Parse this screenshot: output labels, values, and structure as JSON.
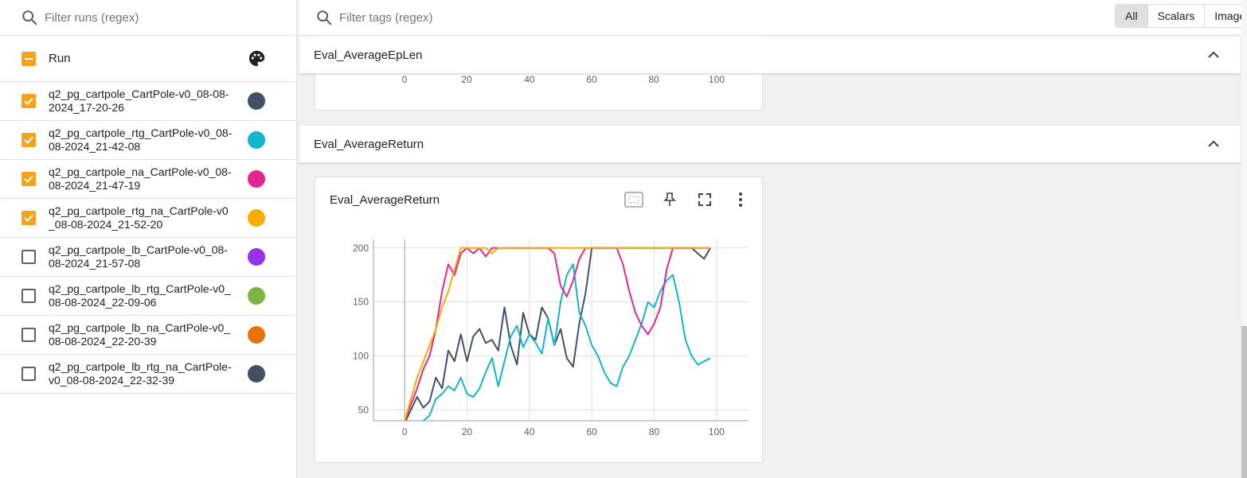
{
  "sidebar": {
    "filter_placeholder": "Filter runs (regex)",
    "header_label": "Run",
    "header_icon": "palette-icon",
    "runs": [
      {
        "name": "q2_pg_cartpole_CartPole-v0_08-08-2024_17-20-26",
        "checked": true,
        "color": "#425066"
      },
      {
        "name": "q2_pg_cartpole_rtg_CartPole-v0_08-08-2024_21-42-08",
        "checked": true,
        "color": "#12b5cb"
      },
      {
        "name": "q2_pg_cartpole_na_CartPole-v0_08-08-2024_21-47-19",
        "checked": true,
        "color": "#e52592"
      },
      {
        "name": "q2_pg_cartpole_rtg_na_CartPole-v0_08-08-2024_21-52-20",
        "checked": true,
        "color": "#f9ab00"
      },
      {
        "name": "q2_pg_cartpole_lb_CartPole-v0_08-08-2024_21-57-08",
        "checked": false,
        "color": "#9334e6"
      },
      {
        "name": "q2_pg_cartpole_lb_rtg_CartPole-v0_08-08-2024_22-09-06",
        "checked": false,
        "color": "#7cb342"
      },
      {
        "name": "q2_pg_cartpole_lb_na_CartPole-v0_08-08-2024_22-20-39",
        "checked": false,
        "color": "#e8710a"
      },
      {
        "name": "q2_pg_cartpole_lb_rtg_na_CartPole-v0_08-08-2024_22-32-39",
        "checked": false,
        "color": "#425066"
      }
    ]
  },
  "topbar": {
    "filter_placeholder": "Filter tags (regex)",
    "tabs": [
      "All",
      "Scalars",
      "Image"
    ],
    "active_tab": "All"
  },
  "groups": {
    "group1_title": "Eval_AverageEpLen",
    "group2_title": "Eval_AverageReturn"
  },
  "card": {
    "title": "Eval_AverageReturn",
    "tools": [
      "fit-domain-icon",
      "pin-icon",
      "fullscreen-icon",
      "more-vert-icon"
    ]
  },
  "prev_card_xticks": [
    "0",
    "20",
    "40",
    "60",
    "80",
    "100"
  ],
  "chart_data": {
    "type": "line",
    "title": "Eval_AverageReturn",
    "xlabel": "",
    "ylabel": "",
    "xlim": [
      -10,
      110
    ],
    "ylim": [
      40,
      205
    ],
    "xticks": [
      0,
      20,
      40,
      60,
      80,
      100
    ],
    "yticks": [
      50,
      100,
      150,
      200
    ],
    "grid": true,
    "series": [
      {
        "name": "q2_pg_cartpole_CartPole-v0_08-08-2024_17-20-26",
        "color": "#425066",
        "x": [
          0,
          2,
          4,
          6,
          8,
          10,
          12,
          14,
          16,
          18,
          20,
          22,
          24,
          26,
          28,
          30,
          32,
          34,
          36,
          38,
          40,
          42,
          44,
          46,
          48,
          50,
          52,
          54,
          56,
          58,
          60,
          62,
          64,
          66,
          68,
          70,
          72,
          74,
          76,
          78,
          80,
          82,
          84,
          86,
          88,
          90,
          92,
          94,
          96,
          98
        ],
        "y": [
          38,
          50,
          62,
          52,
          58,
          80,
          70,
          105,
          95,
          120,
          95,
          118,
          125,
          112,
          115,
          105,
          145,
          110,
          92,
          140,
          120,
          115,
          145,
          135,
          110,
          125,
          98,
          90,
          130,
          158,
          200,
          200,
          200,
          200,
          200,
          200,
          200,
          200,
          200,
          200,
          200,
          200,
          200,
          200,
          200,
          200,
          200,
          195,
          190,
          200
        ]
      },
      {
        "name": "q2_pg_cartpole_rtg_CartPole-v0_08-08-2024_21-42-08",
        "color": "#12b5cb",
        "x": [
          0,
          2,
          4,
          6,
          8,
          10,
          12,
          14,
          16,
          18,
          20,
          22,
          24,
          26,
          28,
          30,
          32,
          34,
          36,
          38,
          40,
          42,
          44,
          46,
          48,
          50,
          52,
          54,
          56,
          58,
          60,
          62,
          64,
          66,
          68,
          70,
          72,
          74,
          76,
          78,
          80,
          82,
          84,
          86,
          88,
          90,
          92,
          94,
          96,
          98
        ],
        "y": [
          20,
          28,
          35,
          40,
          45,
          60,
          65,
          72,
          68,
          80,
          65,
          62,
          70,
          85,
          98,
          72,
          95,
          118,
          128,
          108,
          120,
          112,
          102,
          135,
          110,
          150,
          175,
          185,
          140,
          128,
          110,
          100,
          85,
          75,
          72,
          90,
          100,
          115,
          130,
          150,
          145,
          160,
          170,
          175,
          150,
          115,
          100,
          92,
          95,
          98
        ]
      },
      {
        "name": "q2_pg_cartpole_na_CartPole-v0_08-08-2024_21-47-19",
        "color": "#e52592",
        "x": [
          0,
          2,
          4,
          6,
          8,
          10,
          12,
          14,
          16,
          18,
          20,
          22,
          24,
          26,
          28,
          30,
          32,
          34,
          36,
          38,
          40,
          42,
          44,
          46,
          48,
          50,
          52,
          54,
          56,
          58,
          60,
          62,
          64,
          66,
          68,
          70,
          72,
          74,
          76,
          78,
          80,
          82,
          84,
          86,
          88,
          90,
          92,
          94,
          96,
          98
        ],
        "y": [
          40,
          55,
          70,
          88,
          100,
          125,
          160,
          185,
          175,
          195,
          200,
          195,
          200,
          192,
          200,
          200,
          200,
          200,
          200,
          200,
          200,
          200,
          200,
          200,
          195,
          165,
          155,
          170,
          190,
          200,
          200,
          200,
          200,
          200,
          200,
          185,
          160,
          140,
          128,
          120,
          130,
          145,
          180,
          200,
          200,
          200,
          200,
          200,
          200,
          200
        ]
      },
      {
        "name": "q2_pg_cartpole_rtg_na_CartPole-v0_08-08-2024_21-52-20",
        "color": "#f9ab00",
        "x": [
          0,
          2,
          4,
          6,
          8,
          10,
          12,
          14,
          16,
          18,
          20,
          22,
          24,
          26,
          28,
          30,
          32,
          34,
          36,
          38,
          40,
          42,
          44,
          46,
          48,
          50,
          52,
          54,
          56,
          58,
          60,
          62,
          64,
          66,
          68,
          70,
          72,
          74,
          76,
          78,
          80,
          82,
          84,
          86,
          88,
          90,
          92,
          94,
          96,
          98
        ],
        "y": [
          40,
          60,
          80,
          95,
          110,
          125,
          145,
          160,
          180,
          200,
          200,
          200,
          200,
          200,
          195,
          200,
          200,
          200,
          200,
          200,
          200,
          200,
          200,
          200,
          200,
          200,
          200,
          200,
          200,
          200,
          200,
          200,
          200,
          200,
          200,
          200,
          200,
          200,
          200,
          200,
          200,
          200,
          200,
          200,
          200,
          200,
          200,
          200,
          200,
          200
        ]
      }
    ]
  }
}
